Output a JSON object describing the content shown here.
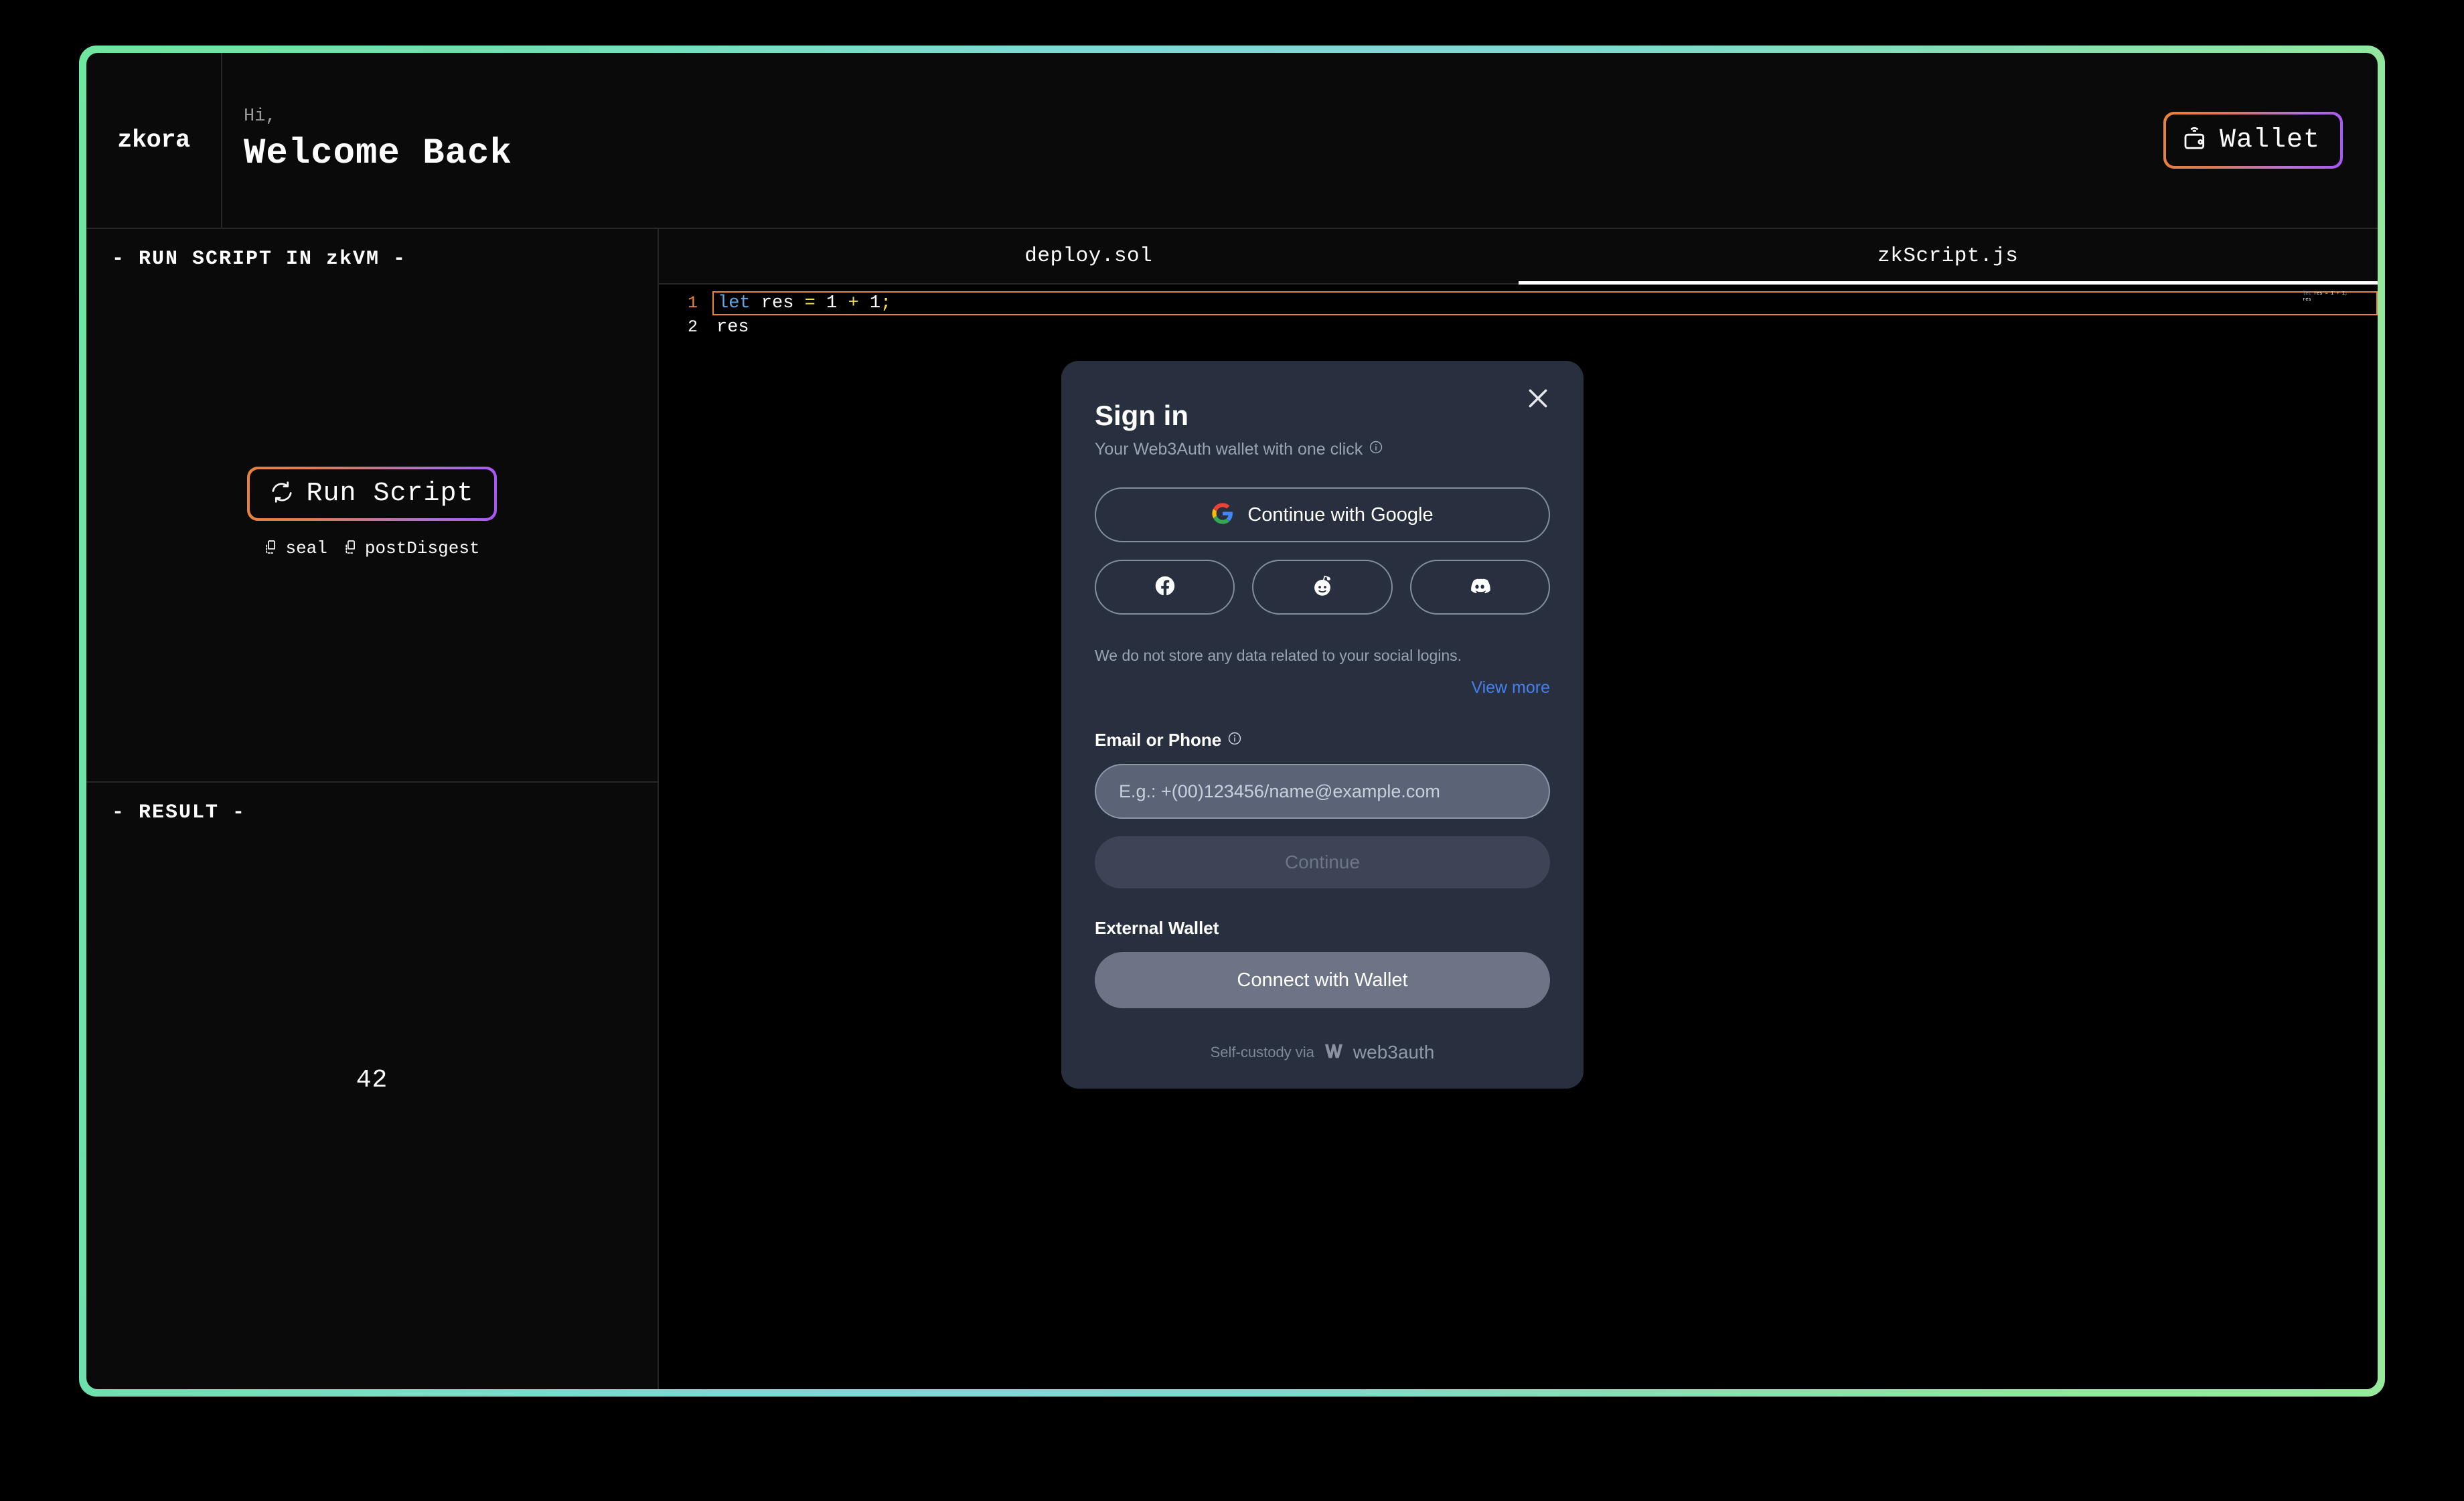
{
  "theme": {
    "frame_gradient_start": "#6ee7a0",
    "frame_gradient_mid": "#83d6d6",
    "frame_gradient_end": "#97ea9c",
    "accent_orange": "#e8833a",
    "accent_purple": "#a855f7",
    "page_bg": "#000000",
    "panel_bg": "#0a0a0a",
    "modal_bg": "#28303f",
    "link_blue": "#4680f0"
  },
  "header": {
    "brand": "zkora",
    "greeting_small": "Hi,",
    "greeting_title": "Welcome Back",
    "wallet_button": {
      "label": "Wallet",
      "icon": "wallet-wifi-icon"
    }
  },
  "left_panel": {
    "run_section": {
      "heading": "- RUN SCRIPT IN zkVM -",
      "run_button": {
        "label": "Run Script",
        "icon": "refresh-icon"
      },
      "artifacts": [
        {
          "label": "seal",
          "icon": "copy-icon"
        },
        {
          "label": "postDisgest",
          "icon": "copy-icon"
        }
      ]
    },
    "result_section": {
      "heading": "- RESULT -",
      "value": "42"
    }
  },
  "editor": {
    "tabs": [
      {
        "label": "deploy.sol",
        "active": false
      },
      {
        "label": "zkScript.js",
        "active": true
      }
    ],
    "lines": [
      {
        "number": "1",
        "active": true,
        "tokens": [
          {
            "text": "let",
            "type": "kw"
          },
          {
            "text": " ",
            "type": "id"
          },
          {
            "text": "res",
            "type": "id"
          },
          {
            "text": " ",
            "type": "id"
          },
          {
            "text": "=",
            "type": "op"
          },
          {
            "text": " ",
            "type": "id"
          },
          {
            "text": "1",
            "type": "num"
          },
          {
            "text": " ",
            "type": "id"
          },
          {
            "text": "+",
            "type": "op"
          },
          {
            "text": " ",
            "type": "id"
          },
          {
            "text": "1",
            "type": "num"
          },
          {
            "text": ";",
            "type": "pun"
          }
        ]
      },
      {
        "number": "2",
        "active": false,
        "tokens": [
          {
            "text": "res",
            "type": "id"
          }
        ]
      }
    ]
  },
  "modal": {
    "close_icon": "close-icon",
    "title": "Sign in",
    "subtitle": "Your Web3Auth wallet with one click",
    "subtitle_icon": "info-icon",
    "google_button": {
      "label": "Continue with Google",
      "icon": "google-icon"
    },
    "social_buttons": [
      {
        "name": "facebook",
        "icon": "facebook-icon"
      },
      {
        "name": "reddit",
        "icon": "reddit-icon"
      },
      {
        "name": "discord",
        "icon": "discord-icon"
      }
    ],
    "privacy_note": "We do not store any data related to your social logins.",
    "view_more": "View more",
    "email_label": "Email or Phone",
    "email_label_icon": "info-icon",
    "email_placeholder": "E.g.: +(00)123456/name@example.com",
    "email_value": "",
    "continue_label": "Continue",
    "continue_disabled": true,
    "external_wallet_label": "External Wallet",
    "connect_wallet_label": "Connect with Wallet",
    "footer_text": "Self-custody via",
    "footer_brand": "web3auth",
    "footer_icon": "web3auth-logo-icon"
  }
}
